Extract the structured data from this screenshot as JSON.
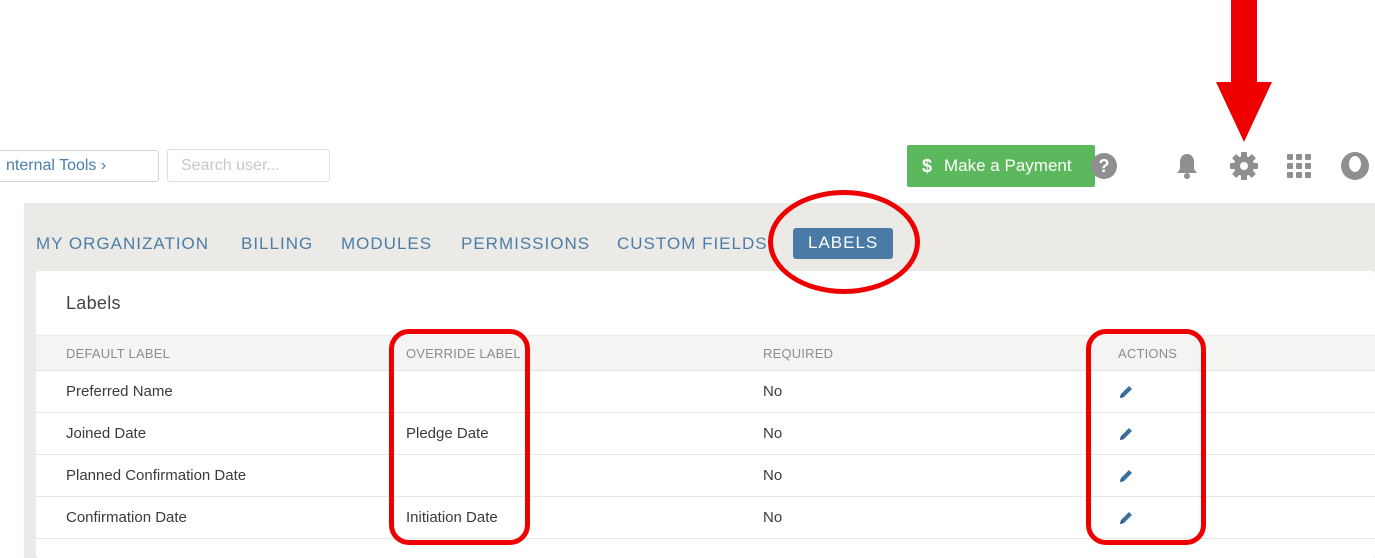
{
  "topbar": {
    "breadcrumb": "nternal Tools ›",
    "search_placeholder": "Search user...",
    "payment_icon": "$",
    "payment_label": "Make a Payment",
    "icons": [
      "help-icon",
      "bell-icon",
      "gear-icon",
      "apps-grid-icon",
      "user-avatar-icon"
    ]
  },
  "tabs": [
    {
      "label": "MY ORGANIZATION",
      "active": false
    },
    {
      "label": "BILLING",
      "active": false
    },
    {
      "label": "MODULES",
      "active": false
    },
    {
      "label": "PERMISSIONS",
      "active": false
    },
    {
      "label": "CUSTOM FIELDS",
      "active": false
    },
    {
      "label": "LABELS",
      "active": true
    }
  ],
  "card": {
    "title": "Labels",
    "columns": [
      "DEFAULT LABEL",
      "OVERRIDE LABEL",
      "REQUIRED",
      "ACTIONS"
    ],
    "rows": [
      {
        "default_label": "Preferred Name",
        "override_label": "",
        "required": "No"
      },
      {
        "default_label": "Joined Date",
        "override_label": "Pledge Date",
        "required": "No"
      },
      {
        "default_label": "Planned Confirmation Date",
        "override_label": "",
        "required": "No"
      },
      {
        "default_label": "Confirmation Date",
        "override_label": "Initiation Date",
        "required": "No"
      }
    ]
  },
  "colors": {
    "accent": "#4a7aa6",
    "payment_green": "#5cb85c",
    "annotation_red": "#ee0000"
  }
}
